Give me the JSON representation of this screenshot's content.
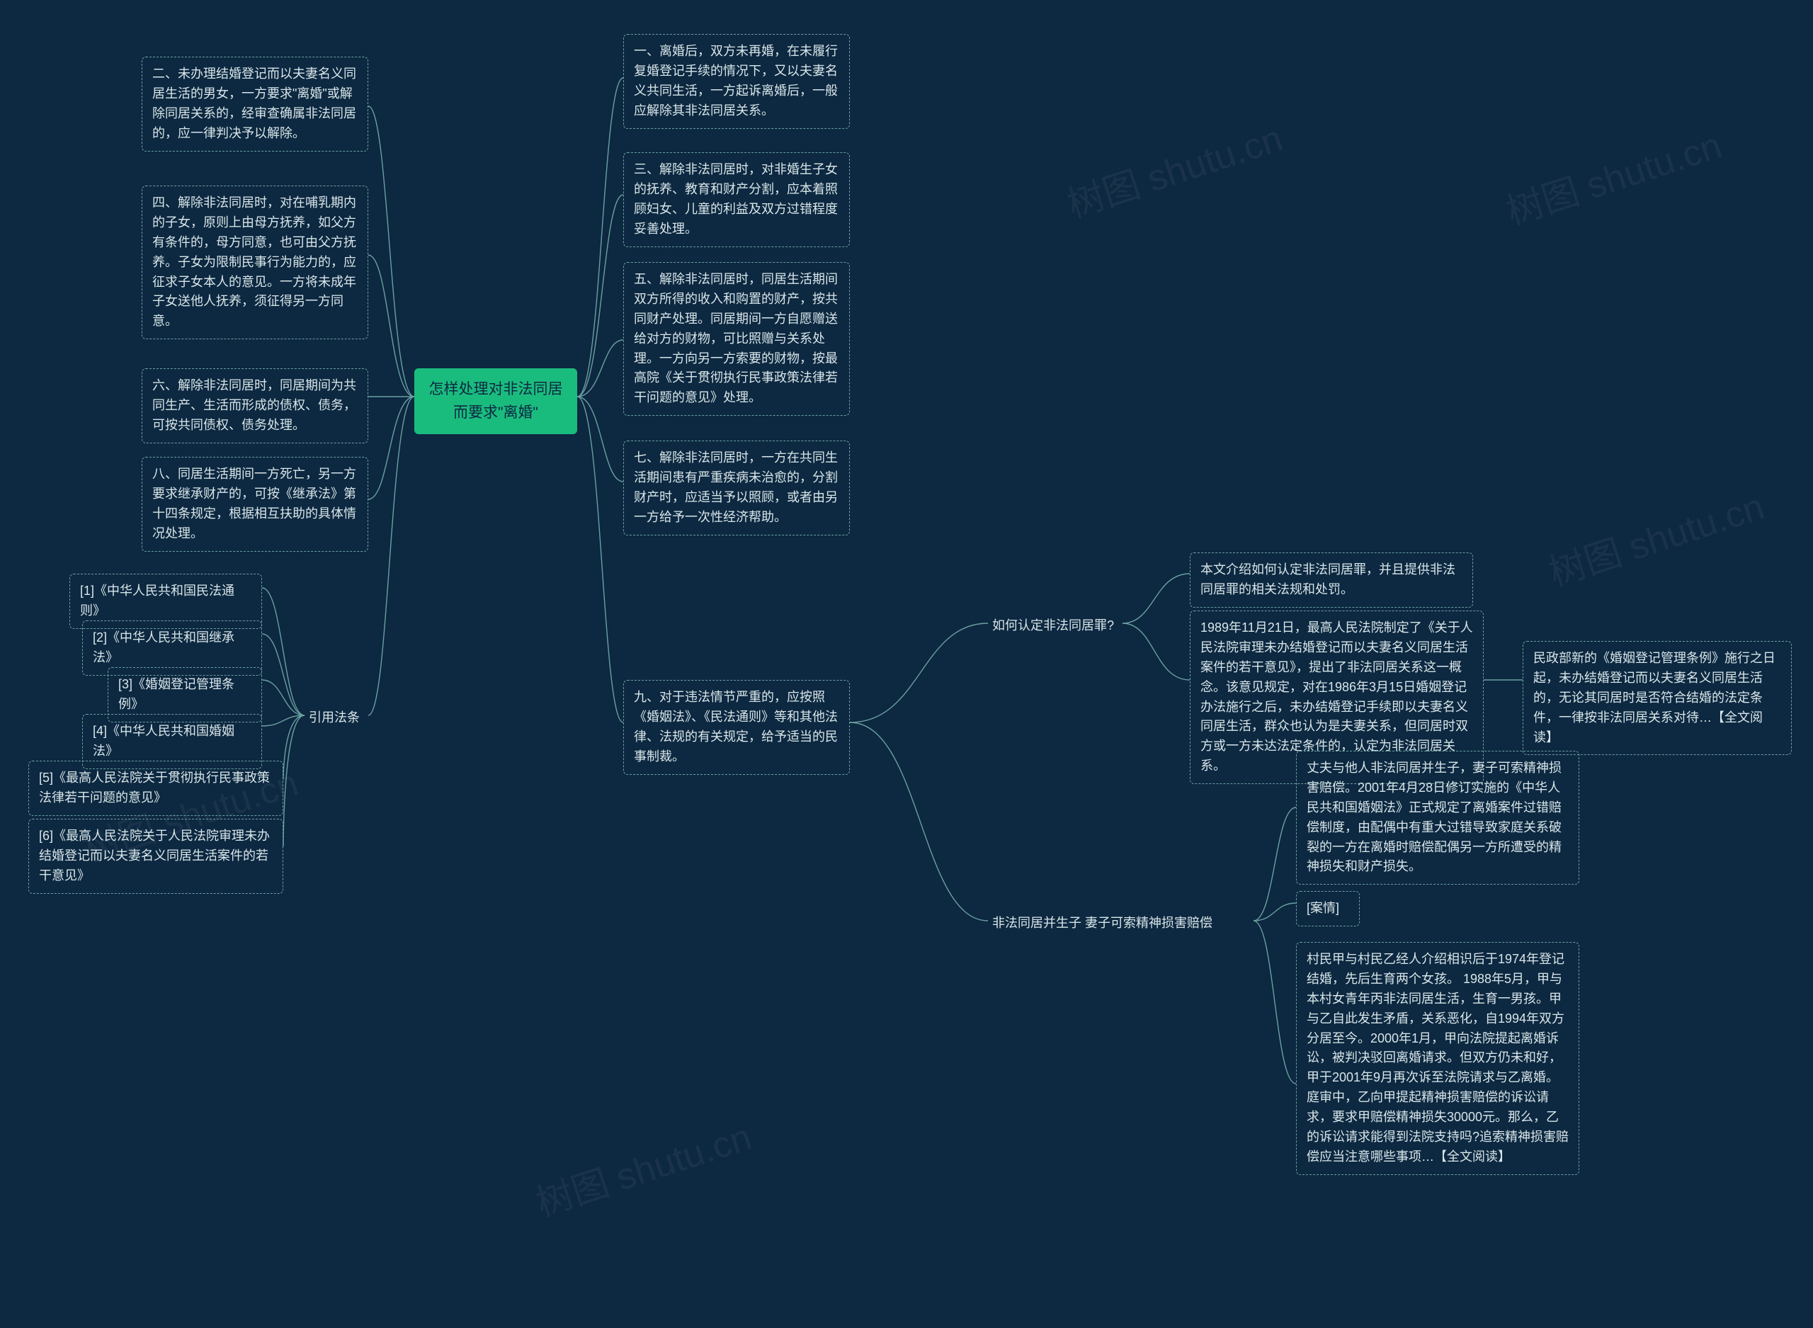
{
  "root": {
    "title": "怎样处理对非法同居而要求\"离婚\""
  },
  "right": {
    "n1": "一、离婚后，双方未再婚，在未履行复婚登记手续的情况下，又以夫妻名义共同生活，一方起诉离婚后，一般应解除其非法同居关系。",
    "n3": "三、解除非法同居时，对非婚生子女的抚养、教育和财产分割，应本着照顾妇女、儿童的利益及双方过错程度妥善处理。",
    "n5": "五、解除非法同居时，同居生活期间双方所得的收入和购置的财产，按共同财产处理。同居期间一方自愿赠送给对方的财物，可比照赠与关系处理。一方向另一方索要的财物，按最高院《关于贯彻执行民事政策法律若干问题的意见》处理。",
    "n7": "七、解除非法同居时，一方在共同生活期间患有严重疾病未治愈的，分割财产时，应适当予以照顾，或者由另一方给予一次性经济帮助。",
    "n9": "九、对于违法情节严重的，应按照《婚姻法》、《民法通则》等和其他法律、法规的有关规定，给予适当的民事制裁。",
    "q_rd": "如何认定非法同居罪?",
    "q_rd_c1": "本文介绍如何认定非法同居罪，并且提供非法同居罪的相关法规和处罚。",
    "q_rd_c2": "1989年11月21日，最高人民法院制定了《关于人民法院审理未办结婚登记而以夫妻名义同居生活案件的若干意见》，提出了非法同居关系这一概念。该意见规定，对在1986年3月15日婚姻登记办法施行之后，未办结婚登记手续即以夫妻名义同居生活，群众也认为是夫妻关系，但同居时双方或一方未达法定条件的，认定为非法同居关系。",
    "q_rd_c2b": "民政部新的《婚姻登记管理条例》施行之日起，未办结婚登记而以夫妻名义同居生活的，无论其同居时是否符合结婚的法定条件，一律按非法同居关系对待…【全文阅读】",
    "q_il": "非法同居并生子 妻子可索精神损害赔偿",
    "q_il_c1": "丈夫与他人非法同居并生子，妻子可索精神损害赔偿。2001年4月28日修订实施的《中华人民共和国婚姻法》正式规定了离婚案件过错赔偿制度，由配偶中有重大过错导致家庭关系破裂的一方在离婚时赔偿配偶另一方所遭受的精神损失和财产损失。",
    "q_il_c2": "[案情]",
    "q_il_c3": "村民甲与村民乙经人介绍相识后于1974年登记结婚，先后生育两个女孩。 1988年5月，甲与本村女青年丙非法同居生活，生育一男孩。甲与乙自此发生矛盾，关系恶化，自1994年双方分居至今。2000年1月，甲向法院提起离婚诉讼，被判决驳回离婚请求。但双方仍未和好，甲于2001年9月再次诉至法院请求与乙离婚。庭审中，乙向甲提起精神损害赔偿的诉讼请求，要求甲赔偿精神损失30000元。那么，乙的诉讼请求能得到法院支持吗?追索精神损害赔偿应当注意哪些事项…【全文阅读】"
  },
  "left": {
    "n2": "二、未办理结婚登记而以夫妻名义同居生活的男女，一方要求\"离婚\"或解除同居关系的，经审查确属非法同居的，应一律判决予以解除。",
    "n4": "四、解除非法同居时，对在哺乳期内的子女，原则上由母方抚养，如父方有条件的，母方同意，也可由父方抚养。子女为限制民事行为能力的，应征求子女本人的意见。一方将未成年子女送他人抚养，须征得另一方同意。",
    "n6": "六、解除非法同居时，同居期间为共同生产、生活而形成的债权、债务，可按共同债权、债务处理。",
    "n8": "八、同居生活期间一方死亡，另一方要求继承财产的，可按《继承法》第十四条规定，根据相互扶助的具体情况处理。",
    "ref": "引用法条",
    "ref1": "[1]《中华人民共和国民法通则》",
    "ref2": "[2]《中华人民共和国继承法》",
    "ref3": "[3]《婚姻登记管理条例》",
    "ref4": "[4]《中华人民共和国婚姻法》",
    "ref5": "[5]《最高人民法院关于贯彻执行民事政策法律若干问题的意见》",
    "ref6": "[6]《最高人民法院关于人民法院审理未办结婚登记而以夫妻名义同居生活案件的若干意见》"
  },
  "watermark": "树图 shutu.cn"
}
